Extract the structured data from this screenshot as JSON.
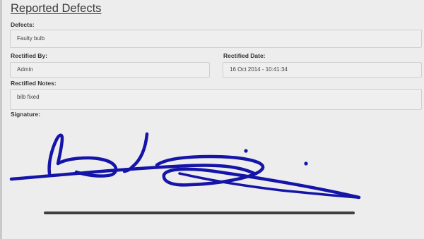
{
  "section": {
    "title": "Reported Defects"
  },
  "form": {
    "defects_label": "Defects:",
    "defects_value": "Faulty bulb",
    "rectified_by_label": "Rectified By:",
    "rectified_by_value": "Admin",
    "rectified_date_label": "Rectified Date:",
    "rectified_date_value": "16 Oct 2014 - 10:41:34",
    "rectified_notes_label": "Rectified Notes:",
    "rectified_notes_value": "bilb fixed",
    "signature_label": "Signature:"
  },
  "colors": {
    "signature_ink": "#1414a8",
    "baseline": "#3f3f3f"
  }
}
